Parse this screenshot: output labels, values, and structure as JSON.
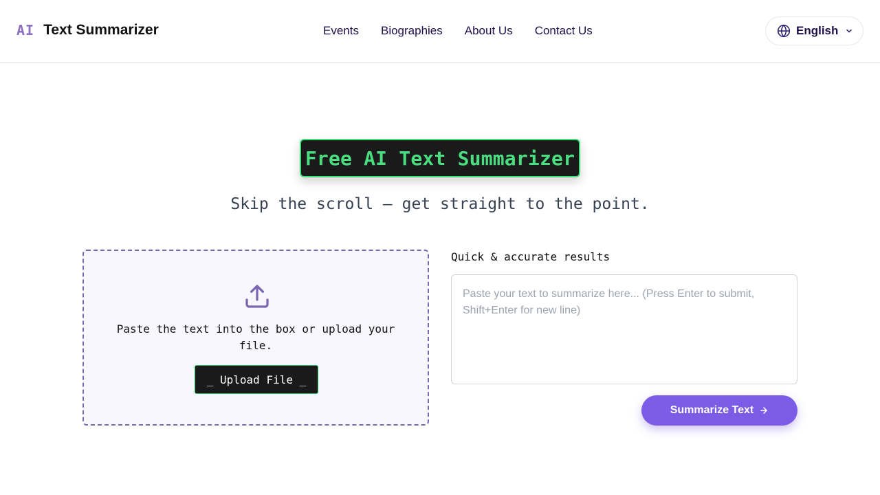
{
  "brand": {
    "mark": "AI",
    "name": "Text Summarizer"
  },
  "nav": {
    "items": [
      {
        "label": "Events"
      },
      {
        "label": "Biographies"
      },
      {
        "label": "About Us"
      },
      {
        "label": "Contact Us"
      }
    ]
  },
  "language": {
    "selected": "English",
    "icon": "globe-icon"
  },
  "hero": {
    "title": "Free AI Text Summarizer",
    "subtitle": "Skip the scroll — get straight to the point."
  },
  "upload": {
    "icon": "upload-icon",
    "instructions": "Paste the text into the box or upload your file.",
    "button_label": "_ Upload File _"
  },
  "summarize": {
    "label": "Quick & accurate results",
    "placeholder": "Paste your text to summarize here... (Press Enter to submit, Shift+Enter for new line)",
    "value": "",
    "button_label": "Summarize Text",
    "button_icon": "arrow-right-icon"
  },
  "colors": {
    "accent": "#7c5ce6",
    "terminal_green": "#4ade80",
    "nav_text": "#1e0f4a",
    "dashed_border": "#7c68b0"
  }
}
